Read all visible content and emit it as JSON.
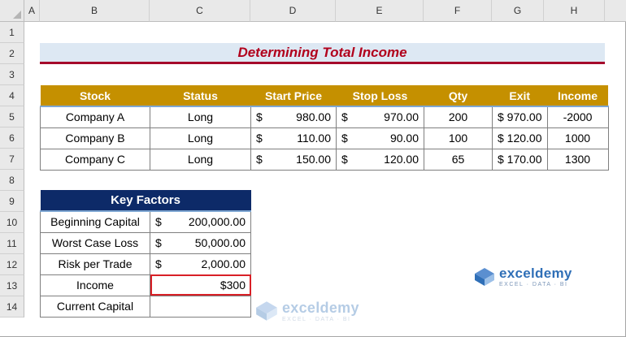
{
  "columns": [
    "A",
    "B",
    "C",
    "D",
    "E",
    "F",
    "G",
    "H"
  ],
  "rows": [
    "1",
    "2",
    "3",
    "4",
    "5",
    "6",
    "7",
    "8",
    "9",
    "10",
    "11",
    "12",
    "13",
    "14"
  ],
  "title": "Determining Total Income",
  "main_table": {
    "headers": [
      "Stock",
      "Status",
      "Start Price",
      "Stop Loss",
      "Qty",
      "Exit",
      "Income"
    ],
    "rows": [
      {
        "stock": "Company A",
        "status": "Long",
        "start_cur": "$",
        "start": "980.00",
        "stop_cur": "$",
        "stop": "970.00",
        "qty": "200",
        "exit": "$ 970.00",
        "income": "-2000"
      },
      {
        "stock": "Company B",
        "status": "Long",
        "start_cur": "$",
        "start": "110.00",
        "stop_cur": "$",
        "stop": "90.00",
        "qty": "100",
        "exit": "$ 120.00",
        "income": "1000"
      },
      {
        "stock": "Company C",
        "status": "Long",
        "start_cur": "$",
        "start": "150.00",
        "stop_cur": "$",
        "stop": "120.00",
        "qty": "65",
        "exit": "$ 170.00",
        "income": "1300"
      }
    ]
  },
  "key_table": {
    "header": "Key Factors",
    "rows": [
      {
        "label": "Beginning Capital",
        "cur": "$",
        "value": "200,000.00"
      },
      {
        "label": "Worst Case Loss",
        "cur": "$",
        "value": "50,000.00"
      },
      {
        "label": "Risk per Trade",
        "cur": "$",
        "value": "2,000.00"
      },
      {
        "label": "Income",
        "cur": "",
        "value": "$300"
      },
      {
        "label": "Current Capital",
        "cur": "",
        "value": ""
      }
    ]
  },
  "logo": {
    "name": "exceldemy",
    "tagline": "EXCEL · DATA · BI"
  },
  "colors": {
    "header_gold": "#c59000",
    "header_navy": "#0d2a68",
    "title_red": "#b1001c",
    "selection": "#d92027"
  }
}
